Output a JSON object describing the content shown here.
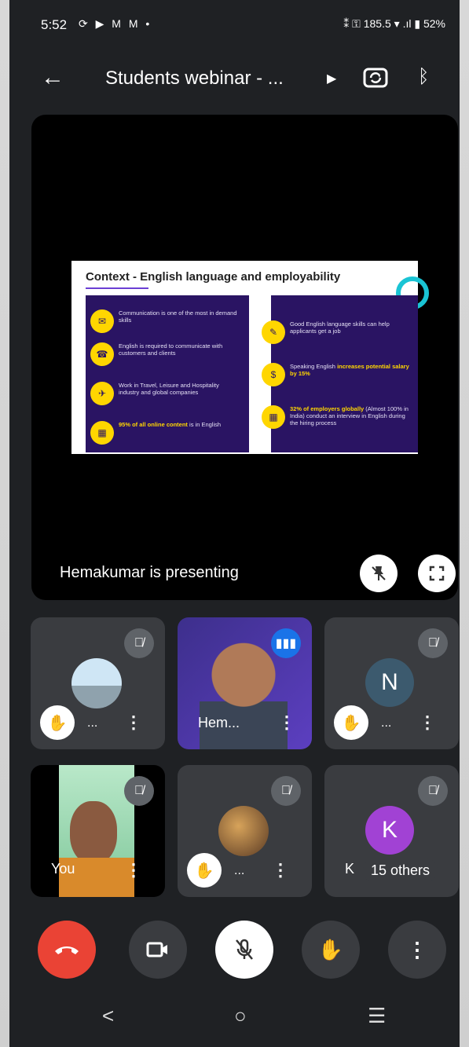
{
  "status_bar": {
    "time": "5:52",
    "left_icons": "⟳ ▶ M M •",
    "right_icons": "⁑ ⚿ 185.5 ▾ .ıl",
    "battery": "52%"
  },
  "header": {
    "title": "Students webinar - ...",
    "back_icon": "arrow-left-icon",
    "switch_camera_icon": "camera-switch-icon",
    "bluetooth_icon": "bluetooth-icon"
  },
  "presentation": {
    "slide": {
      "title": "Context - English language and employability",
      "left_points": [
        {
          "text": "Communication is one of the most in demand skills",
          "highlight": ""
        },
        {
          "text": "English is required to communicate with customers and clients",
          "highlight": ""
        },
        {
          "text": "Work in Travel, Leisure and Hospitality industry and global companies",
          "highlight": ""
        },
        {
          "text": "is in English",
          "highlight": "95% of all online content"
        }
      ],
      "right_points": [
        {
          "text": "Good English language skills can help applicants get a job",
          "highlight": ""
        },
        {
          "text": "Speaking English",
          "highlight": "increases potential salary by 15%"
        },
        {
          "text": "(Almost 100% in India) conduct an interview in English during the hiring process",
          "highlight": "32% of employers globally"
        }
      ]
    },
    "presenter_text": "Hemakumar  is presenting"
  },
  "tiles": [
    {
      "name": "...",
      "type": "photo-avatar"
    },
    {
      "name": "Hem...",
      "type": "video"
    },
    {
      "name": "...",
      "letter": "N",
      "color": "#3c5a6e"
    },
    {
      "name": "You",
      "type": "self-video"
    },
    {
      "name": "...",
      "type": "photo-avatar"
    },
    {
      "name": "K",
      "letter": "K",
      "color": "#a142d4"
    }
  ],
  "others_label": "15 others",
  "controls": {
    "end_call_color": "#ea4335"
  },
  "nav": {
    "back": "<",
    "home": "○",
    "recents": "☰"
  }
}
